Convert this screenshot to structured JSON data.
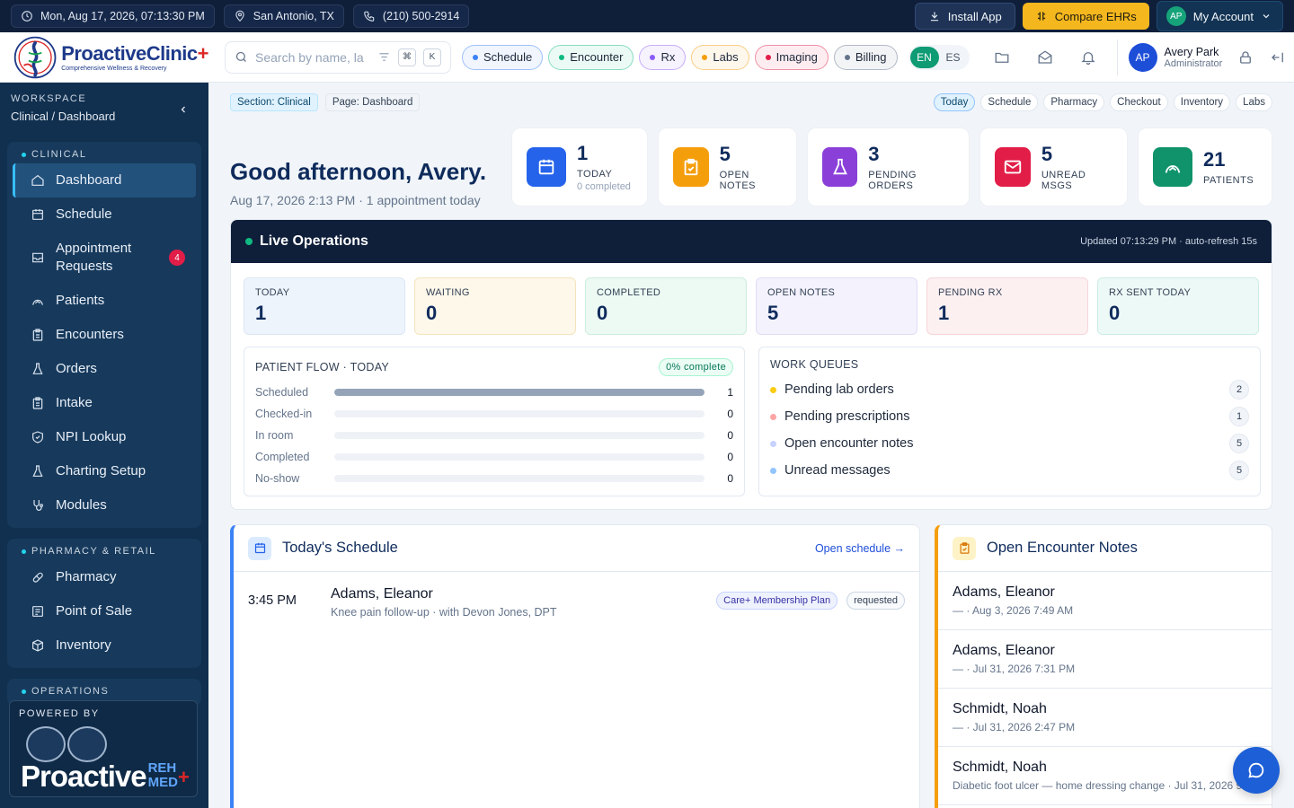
{
  "topbar": {
    "datetime": "Mon, Aug 17, 2026, 07:13:30 PM",
    "location": "San Antonio, TX",
    "phone": "(210) 500-2914",
    "install_label": "Install App",
    "compare_label": "Compare EHRs",
    "account_initials": "AP",
    "account_label": "My Account"
  },
  "header": {
    "logo_name": "ProactiveClinic",
    "logo_tagline": "Comprehensive Wellness & Recovery",
    "search_placeholder": "Search by name, la",
    "kbd_cmd": "⌘",
    "kbd_k": "K",
    "pills": [
      {
        "label": "Schedule",
        "color": "#3b82f6"
      },
      {
        "label": "Encounter",
        "color": "#10b981"
      },
      {
        "label": "Rx",
        "color": "#8b5cf6"
      },
      {
        "label": "Labs",
        "color": "#f59e0b"
      },
      {
        "label": "Imaging",
        "color": "#e11d48"
      },
      {
        "label": "Billing",
        "color": "#64748b"
      }
    ],
    "lang_en": "EN",
    "lang_es": "ES",
    "user_initials": "AP",
    "user_name": "Avery Park",
    "user_role": "Administrator"
  },
  "sidebar": {
    "workspace_label": "WORKSPACE",
    "workspace_value": "Clinical / Dashboard",
    "clinical_heading": "CLINICAL",
    "clinical_items": [
      {
        "label": "Dashboard",
        "icon": "home-icon"
      },
      {
        "label": "Schedule",
        "icon": "calendar-icon"
      },
      {
        "label": "Appointment Requests",
        "icon": "inbox-icon",
        "badge": "4"
      },
      {
        "label": "Patients",
        "icon": "user-arc-icon"
      },
      {
        "label": "Encounters",
        "icon": "clipboard-icon"
      },
      {
        "label": "Orders",
        "icon": "flask-icon"
      },
      {
        "label": "Intake",
        "icon": "clipboard-icon"
      },
      {
        "label": "NPI Lookup",
        "icon": "shield-icon"
      },
      {
        "label": "Charting Setup",
        "icon": "flask-icon"
      },
      {
        "label": "Modules",
        "icon": "stethoscope-icon"
      }
    ],
    "pharmacy_heading": "PHARMACY & RETAIL",
    "pharmacy_items": [
      {
        "label": "Pharmacy",
        "icon": "pill-icon"
      },
      {
        "label": "Point of Sale",
        "icon": "receipt-icon"
      },
      {
        "label": "Inventory",
        "icon": "box-icon"
      }
    ],
    "operations_heading": "OPERATIONS",
    "powered_label": "POWERED BY",
    "powered_word": "Proactive",
    "powered_reh": "REH",
    "powered_med": "MED"
  },
  "main": {
    "crumb_section": "Section: Clinical",
    "crumb_page": "Page: Dashboard",
    "quick_tabs": [
      "Today",
      "Schedule",
      "Pharmacy",
      "Checkout",
      "Inventory",
      "Labs"
    ],
    "greeting": "Good afternoon, Avery.",
    "greeting_sub": "Aug 17, 2026 2:13 PM · 1 appointment today",
    "stats": [
      {
        "value": "1",
        "label": "TODAY",
        "sub": "0 completed",
        "color": "#2563eb",
        "icon": "calendar-icon"
      },
      {
        "value": "5",
        "label": "OPEN NOTES",
        "color": "#f59e0b",
        "icon": "clipboard-check-icon"
      },
      {
        "value": "3",
        "label": "PENDING ORDERS",
        "color": "#8b3fd9",
        "icon": "flask-icon"
      },
      {
        "value": "5",
        "label": "UNREAD MSGS",
        "color": "#e11d48",
        "icon": "mail-icon"
      },
      {
        "value": "21",
        "label": "PATIENTS",
        "color": "#10936b",
        "icon": "user-arc-icon"
      }
    ],
    "live": {
      "title": "Live Operations",
      "updated": "Updated 07:13:29 PM · auto-refresh 15s",
      "kpis": [
        {
          "label": "TODAY",
          "value": "1",
          "bg": "#eef4fc",
          "border": "#dbe6f3"
        },
        {
          "label": "WAITING",
          "value": "0",
          "bg": "#fef8ea",
          "border": "#f4e4bd"
        },
        {
          "label": "COMPLETED",
          "value": "0",
          "bg": "#ecfaf3",
          "border": "#cdeedd"
        },
        {
          "label": "OPEN NOTES",
          "value": "5",
          "bg": "#f3f2fd",
          "border": "#e0ddf6"
        },
        {
          "label": "PENDING RX",
          "value": "1",
          "bg": "#fdf0f1",
          "border": "#f5d6da"
        },
        {
          "label": "RX SENT TODAY",
          "value": "0",
          "bg": "#edf9f6",
          "border": "#cdece4"
        }
      ],
      "flow_title": "PATIENT FLOW · TODAY",
      "flow_pct": "0% complete",
      "flow": [
        {
          "label": "Scheduled",
          "count": "1",
          "fraction": 1
        },
        {
          "label": "Checked-in",
          "count": "0",
          "fraction": 0
        },
        {
          "label": "In room",
          "count": "0",
          "fraction": 0
        },
        {
          "label": "Completed",
          "count": "0",
          "fraction": 0
        },
        {
          "label": "No-show",
          "count": "0",
          "fraction": 0
        }
      ],
      "queues_title": "WORK QUEUES",
      "queues": [
        {
          "label": "Pending lab orders",
          "count": "2",
          "color": "#facc15"
        },
        {
          "label": "Pending prescriptions",
          "count": "1",
          "color": "#fca5a5"
        },
        {
          "label": "Open encounter notes",
          "count": "5",
          "color": "#c7d2fe"
        },
        {
          "label": "Unread messages",
          "count": "5",
          "color": "#93c5fd"
        }
      ]
    },
    "schedule": {
      "title": "Today's Schedule",
      "link": "Open schedule →",
      "items": [
        {
          "time": "3:45 PM",
          "name": "Adams, Eleanor",
          "detail": "Knee pain follow-up · with Devon Jones, DPT",
          "plan": "Care+ Membership Plan",
          "status": "requested"
        }
      ]
    },
    "notes": {
      "title": "Open Encounter Notes",
      "items": [
        {
          "name": "Adams, Eleanor",
          "meta": "— · Aug 3, 2026 7:49 AM"
        },
        {
          "name": "Adams, Eleanor",
          "meta": "— · Jul 31, 2026 7:31 PM"
        },
        {
          "name": "Schmidt, Noah",
          "meta": "— · Jul 31, 2026 2:47 PM"
        },
        {
          "name": "Schmidt, Noah",
          "meta": "Diabetic foot ulcer — home dressing change · Jul 31, 2026 9"
        }
      ]
    }
  }
}
